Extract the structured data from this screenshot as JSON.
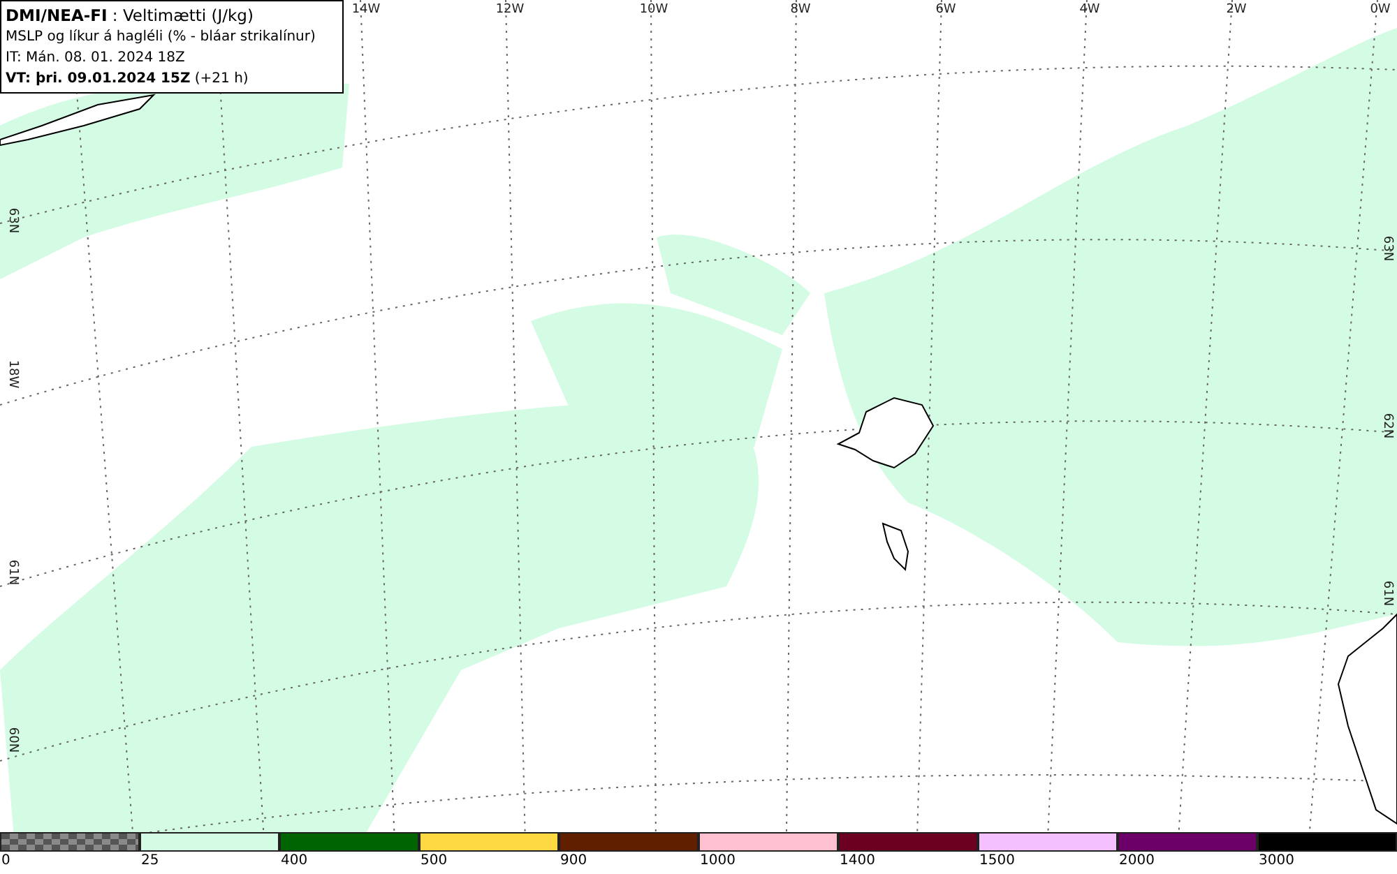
{
  "title_box": {
    "lines": [
      "**DMI/NEA-FI** : Veltimætti (J/kg)",
      "MSLP og líkur á hagléli (% - bláar strikalínur)",
      "IT: Mán. 08. 01. 2024 18Z",
      "**VT: þri. 09.01.2024 15Z** (+21 h)"
    ]
  },
  "map": {
    "top_labels": [
      "14W",
      "12W",
      "10W",
      "8W",
      "6W",
      "4W",
      "2W",
      "0W"
    ],
    "left_labels": [
      "63N",
      "18W",
      "61N",
      "60N"
    ],
    "right_labels": [
      "63N",
      "62N",
      "61N"
    ]
  },
  "legend": [
    {
      "kind": "checker",
      "color": "#555555",
      "label": "0"
    },
    {
      "kind": "solid",
      "color": "#d4fce4",
      "label": "25"
    },
    {
      "kind": "solid",
      "color": "#006400",
      "label": "400"
    },
    {
      "kind": "solid",
      "color": "#ffd944",
      "label": "500"
    },
    {
      "kind": "solid",
      "color": "#602000",
      "label": "900"
    },
    {
      "kind": "solid",
      "color": "#ffc0d0",
      "label": "1000"
    },
    {
      "kind": "solid",
      "color": "#6c0020",
      "label": "1400"
    },
    {
      "kind": "solid",
      "color": "#f4c0ff",
      "label": "1500"
    },
    {
      "kind": "solid",
      "color": "#6c0068",
      "label": "2000"
    },
    {
      "kind": "solid",
      "color": "#000000",
      "label": "3000"
    }
  ]
}
